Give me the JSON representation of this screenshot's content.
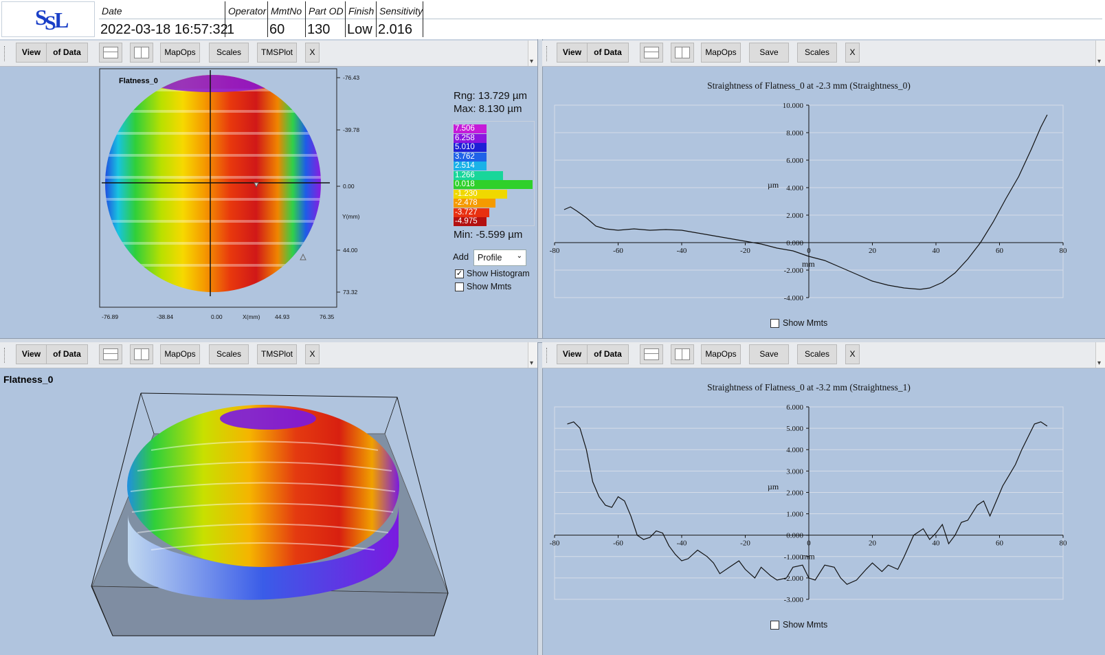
{
  "header": {
    "logo": "SSL",
    "columns": [
      {
        "label": "Date",
        "value": "2022-03-18 16:57:32"
      },
      {
        "label": "Operator",
        "value": "1"
      },
      {
        "label": "MmtNo",
        "value": "60"
      },
      {
        "label": "Part OD",
        "value": "130"
      },
      {
        "label": "Finish",
        "value": "Low"
      },
      {
        "label": "Sensitivity",
        "value": "2.016"
      }
    ]
  },
  "toolbar": {
    "view": "View",
    "of_data": "of Data",
    "mapops": "MapOps",
    "scales": "Scales",
    "tmsplot": "TMSPlot",
    "save": "Save",
    "close": "X"
  },
  "map2d": {
    "title": "Flatness_0",
    "x_ticks": [
      "-76.89",
      "-38.84",
      "0.00",
      "44.93",
      "76.35"
    ],
    "x_label": "X(mm)",
    "y_ticks": [
      "-76.43",
      "-39.78",
      "0.00",
      "44.00",
      "73.32"
    ],
    "y_label": "Y(mm)",
    "stats": {
      "range": "Rng: 13.729 µm",
      "max": "Max: 8.130 µm",
      "min": "Min: -5.599 µm"
    },
    "legend": [
      {
        "label": "7.506",
        "color": "#c61bd8",
        "hist": 0.21
      },
      {
        "label": "6.258",
        "color": "#8a16e0",
        "hist": 0.23
      },
      {
        "label": "5.010",
        "color": "#1d1fd6",
        "hist": 0.25
      },
      {
        "label": "3.762",
        "color": "#1f63e8",
        "hist": 0.28
      },
      {
        "label": "2.514",
        "color": "#1bb2e8",
        "hist": 0.36
      },
      {
        "label": "1.266",
        "color": "#19d69a",
        "hist": 0.63
      },
      {
        "label": "0.018",
        "color": "#2fd02a",
        "hist": 1.0
      },
      {
        "label": "-1.230",
        "color": "#f0d800",
        "hist": 0.68
      },
      {
        "label": "-2.478",
        "color": "#f59a00",
        "hist": 0.53
      },
      {
        "label": "-3.727",
        "color": "#e83010",
        "hist": 0.45
      },
      {
        "label": "-4.975",
        "color": "#b31010",
        "hist": 0.32
      }
    ],
    "add_label": "Add",
    "add_select": "Profile",
    "show_histogram": "Show Histogram",
    "show_mmts": "Show Mmts"
  },
  "map3d": {
    "title": "Flatness_0"
  },
  "chart_data": [
    {
      "type": "line",
      "title": "Straightness of Flatness_0 at -2.3 mm (Straightness_0)",
      "xlabel": "mm",
      "ylabel": "µm",
      "xlim": [
        -80,
        80
      ],
      "ylim": [
        -4,
        10
      ],
      "x_ticks": [
        -80,
        -60,
        -40,
        -20,
        0,
        20,
        40,
        60,
        80
      ],
      "y_ticks": [
        "10.000",
        "8.000",
        "6.000",
        "4.000",
        "2.000",
        "0.000",
        "-2.000",
        "-4.000"
      ],
      "x": [
        -77,
        -75,
        -73,
        -70,
        -67,
        -64,
        -60,
        -55,
        -50,
        -45,
        -40,
        -35,
        -30,
        -25,
        -20,
        -15,
        -10,
        -5,
        0,
        5,
        10,
        15,
        20,
        25,
        30,
        35,
        38,
        42,
        46,
        50,
        54,
        58,
        62,
        66,
        70,
        73,
        75
      ],
      "values": [
        2.4,
        2.6,
        2.3,
        1.8,
        1.2,
        1.0,
        0.9,
        1.0,
        0.9,
        0.95,
        0.9,
        0.7,
        0.5,
        0.3,
        0.1,
        -0.1,
        -0.4,
        -0.6,
        -1.0,
        -1.3,
        -1.8,
        -2.3,
        -2.8,
        -3.1,
        -3.3,
        -3.4,
        -3.3,
        -2.9,
        -2.2,
        -1.2,
        0.0,
        1.5,
        3.2,
        4.8,
        6.8,
        8.4,
        9.3
      ],
      "show_mmts": "Show Mmts"
    },
    {
      "type": "line",
      "title": "Straightness of Flatness_0 at -3.2 mm (Straightness_1)",
      "xlabel": "mm",
      "ylabel": "µm",
      "xlim": [
        -80,
        80
      ],
      "ylim": [
        -3,
        6
      ],
      "x_ticks": [
        -80,
        -60,
        -40,
        -20,
        0,
        20,
        40,
        60,
        80
      ],
      "y_ticks": [
        "6.000",
        "5.000",
        "4.000",
        "3.000",
        "2.000",
        "1.000",
        "0.000",
        "-1.000",
        "-2.000",
        "-3.000"
      ],
      "x": [
        -76,
        -74,
        -72,
        -70,
        -68,
        -66,
        -64,
        -62,
        -60,
        -58,
        -56,
        -54,
        -52,
        -50,
        -48,
        -46,
        -44,
        -42,
        -40,
        -38,
        -35,
        -32,
        -30,
        -28,
        -25,
        -22,
        -20,
        -17,
        -15,
        -12,
        -10,
        -7,
        -5,
        -2,
        0,
        2,
        5,
        8,
        10,
        12,
        15,
        18,
        20,
        23,
        25,
        28,
        30,
        33,
        36,
        38,
        40,
        42,
        44,
        46,
        48,
        50,
        53,
        55,
        57,
        59,
        61,
        63,
        65,
        67,
        69,
        71,
        73,
        75
      ],
      "values": [
        5.2,
        5.3,
        5.0,
        4.0,
        2.5,
        1.8,
        1.4,
        1.3,
        1.8,
        1.6,
        0.9,
        0.0,
        -0.2,
        -0.1,
        0.2,
        0.1,
        -0.5,
        -0.9,
        -1.2,
        -1.1,
        -0.7,
        -1.0,
        -1.3,
        -1.8,
        -1.5,
        -1.2,
        -1.6,
        -2.0,
        -1.5,
        -1.9,
        -2.1,
        -2.0,
        -1.5,
        -1.4,
        -2.0,
        -2.1,
        -1.4,
        -1.5,
        -2.0,
        -2.3,
        -2.1,
        -1.6,
        -1.3,
        -1.7,
        -1.4,
        -1.6,
        -1.0,
        0.0,
        0.3,
        -0.2,
        0.1,
        0.5,
        -0.4,
        0.0,
        0.6,
        0.7,
        1.4,
        1.6,
        0.9,
        1.6,
        2.3,
        2.8,
        3.3,
        4.0,
        4.6,
        5.2,
        5.3,
        5.1
      ],
      "show_mmts": "Show Mmts"
    }
  ]
}
